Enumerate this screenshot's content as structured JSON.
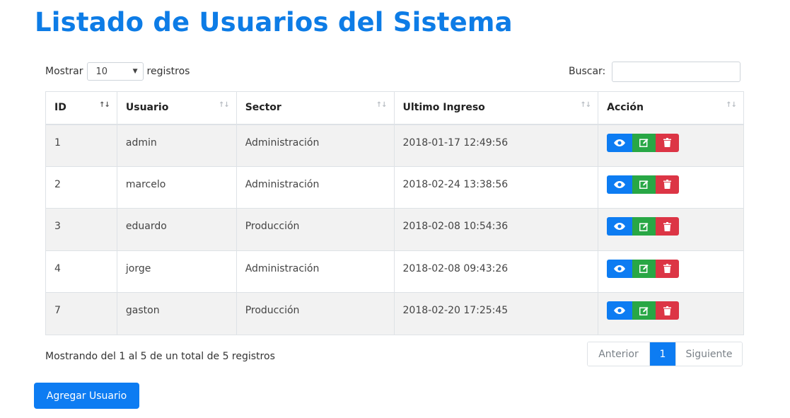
{
  "page": {
    "title": "Listado de Usuarios del Sistema"
  },
  "controls": {
    "show_label": "Mostrar",
    "length_value": "10",
    "records_label": "registros",
    "search_label": "Buscar:",
    "search_value": ""
  },
  "table": {
    "headers": [
      "ID",
      "Usuario",
      "Sector",
      "Ultimo Ingreso",
      "Acción"
    ],
    "rows": [
      {
        "id": "1",
        "usuario": "admin",
        "sector": "Administración",
        "ultimo_ingreso": "2018-01-17 12:49:56"
      },
      {
        "id": "2",
        "usuario": "marcelo",
        "sector": "Administración",
        "ultimo_ingreso": "2018-02-24 13:38:56"
      },
      {
        "id": "3",
        "usuario": "eduardo",
        "sector": "Producción",
        "ultimo_ingreso": "2018-02-08 10:54:36"
      },
      {
        "id": "4",
        "usuario": "jorge",
        "sector": "Administración",
        "ultimo_ingreso": "2018-02-08 09:43:26"
      },
      {
        "id": "7",
        "usuario": "gaston",
        "sector": "Producción",
        "ultimo_ingreso": "2018-02-20 17:25:45"
      }
    ],
    "actions": {
      "view_icon": "eye-icon",
      "edit_icon": "edit-icon",
      "delete_icon": "trash-icon"
    }
  },
  "footer": {
    "info": "Mostrando del 1 al 5 de un total de 5 registros",
    "prev_label": "Anterior",
    "current_page": "1",
    "next_label": "Siguiente"
  },
  "add_button": {
    "label": "Agregar Usuario"
  },
  "colors": {
    "primary": "#0d7cf2",
    "success": "#28a745",
    "danger": "#dc3545",
    "title": "#0d7ce6"
  }
}
